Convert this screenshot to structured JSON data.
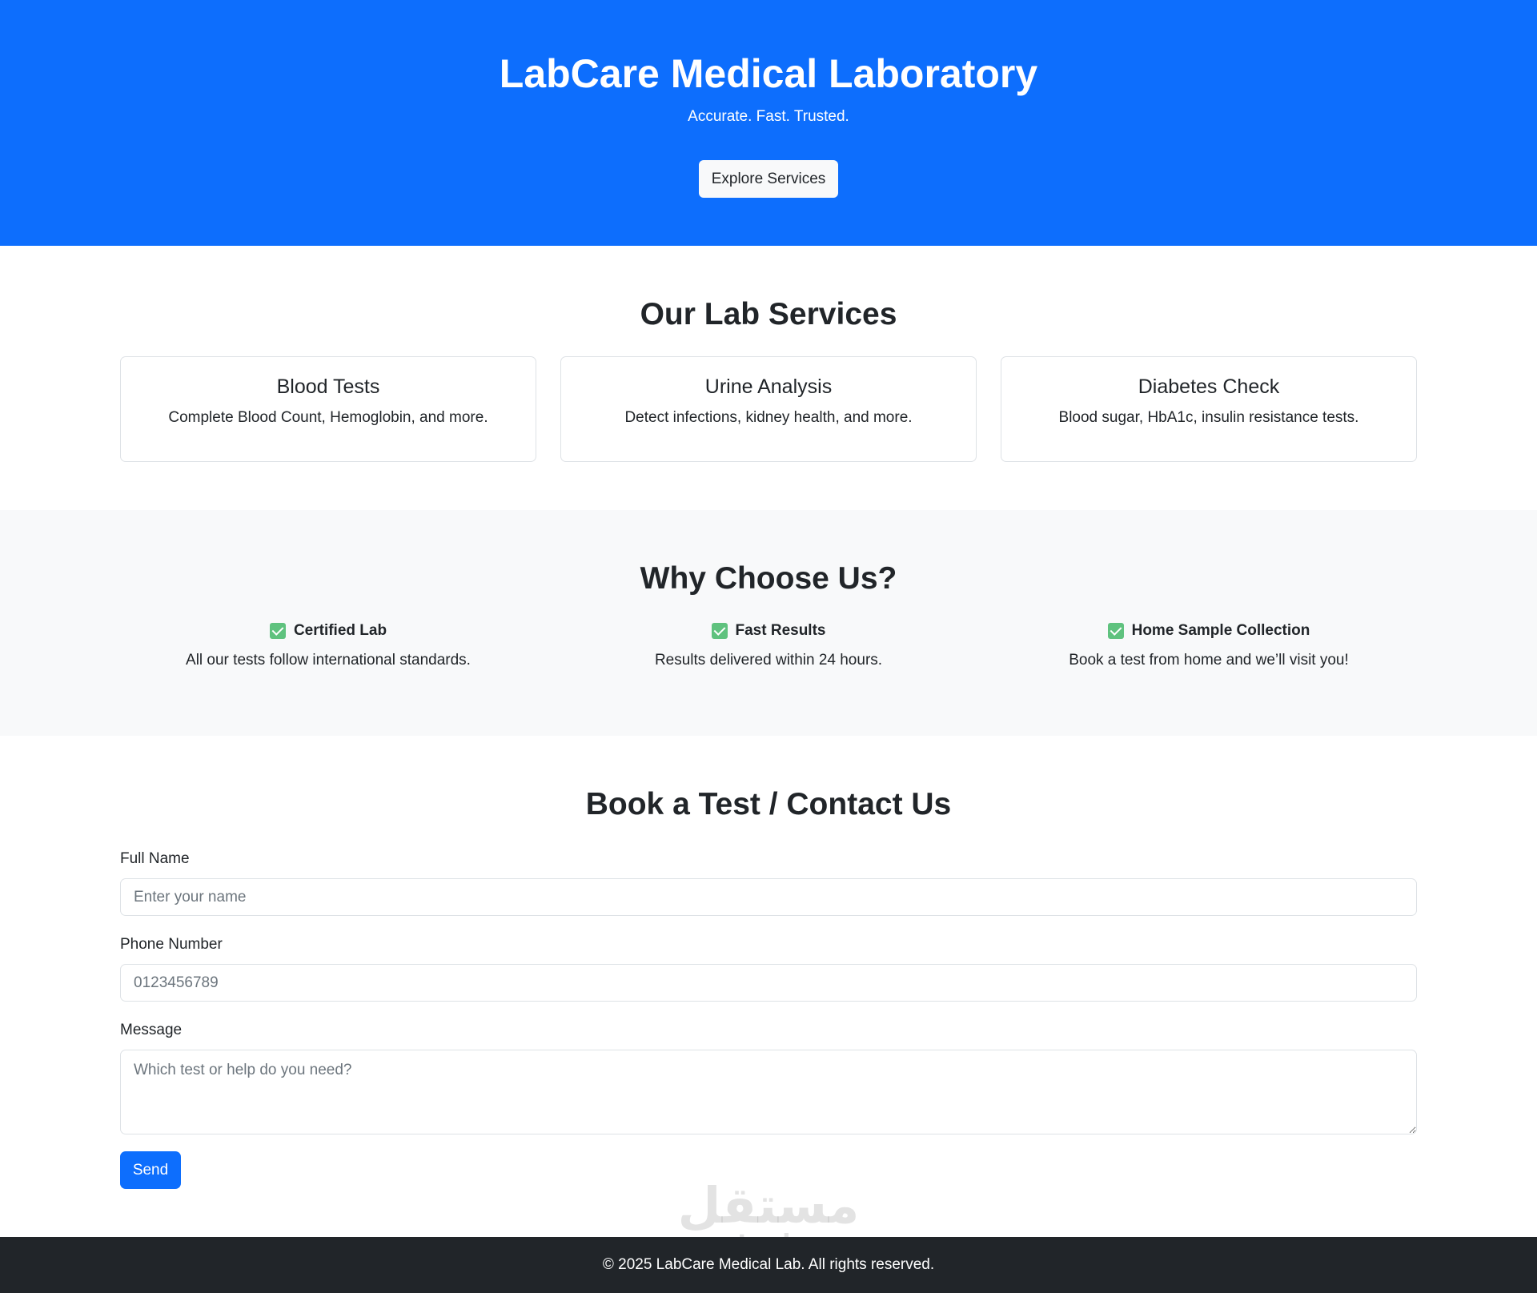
{
  "hero": {
    "title": "LabCare Medical Laboratory",
    "tagline": "Accurate. Fast. Trusted.",
    "cta_label": "Explore Services"
  },
  "services": {
    "title": "Our Lab Services",
    "items": [
      {
        "title": "Blood Tests",
        "description": "Complete Blood Count, Hemoglobin, and more."
      },
      {
        "title": "Urine Analysis",
        "description": "Detect infections, kidney health, and more."
      },
      {
        "title": "Diabetes Check",
        "description": "Blood sugar, HbA1c, insulin resistance tests."
      }
    ]
  },
  "why": {
    "title": "Why Choose Us?",
    "features": [
      {
        "icon": "check-box-icon",
        "title": "Certified Lab",
        "description": "All our tests follow international standards."
      },
      {
        "icon": "check-box-icon",
        "title": "Fast Results",
        "description": "Results delivered within 24 hours."
      },
      {
        "icon": "check-box-icon",
        "title": "Home Sample Collection",
        "description": "Book a test from home and we’ll visit you!"
      }
    ]
  },
  "contact": {
    "title": "Book a Test / Contact Us",
    "name_label": "Full Name",
    "name_placeholder": "Enter your name",
    "phone_label": "Phone Number",
    "phone_placeholder": "0123456789",
    "message_label": "Message",
    "message_placeholder": "Which test or help do you need?",
    "send_label": "Send"
  },
  "watermark": {
    "arabic": "مستقل",
    "latin": "mostaql.com"
  },
  "footer": {
    "text": "© 2025 LabCare Medical Lab. All rights reserved."
  },
  "colors": {
    "primary": "#0d6efd",
    "light_bg": "#f8f9fa",
    "dark_footer": "#212529",
    "check_green": "#5fc27e"
  }
}
